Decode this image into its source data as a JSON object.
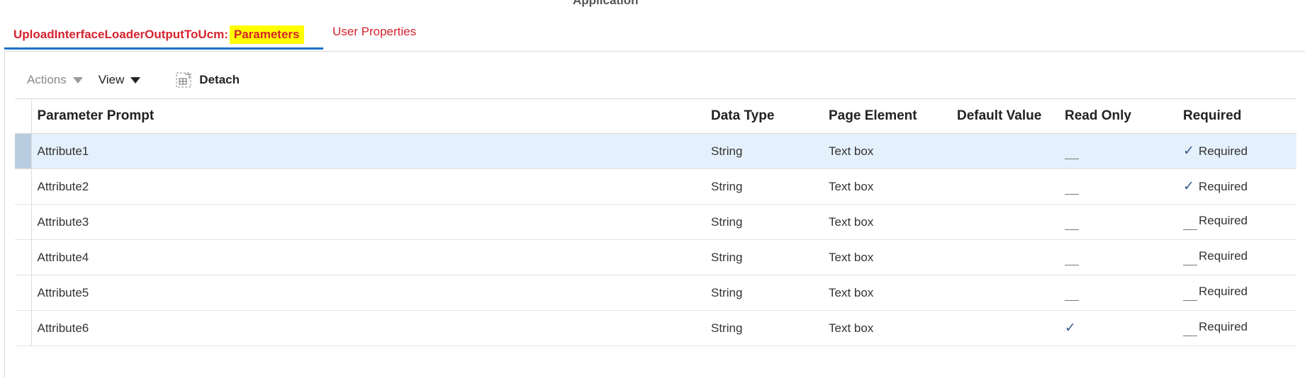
{
  "header": {
    "cut_title": "Application"
  },
  "tabs": {
    "active_prefix": "UploadInterfaceLoaderOutputToUcm:",
    "active_highlight": "Parameters",
    "user_properties": "User Properties"
  },
  "toolbar": {
    "actions_label": "Actions",
    "view_label": "View",
    "detach_label": "Detach"
  },
  "table": {
    "columns": [
      "Parameter Prompt",
      "Data Type",
      "Page Element",
      "Default Value",
      "Read Only",
      "Required"
    ],
    "rows": [
      {
        "prompt": "Attribute1",
        "type": "String",
        "element": "Text box",
        "default": "",
        "read_only": false,
        "required": true,
        "required_label": "Required",
        "selected": true
      },
      {
        "prompt": "Attribute2",
        "type": "String",
        "element": "Text box",
        "default": "",
        "read_only": false,
        "required": true,
        "required_label": "Required",
        "selected": false
      },
      {
        "prompt": "Attribute3",
        "type": "String",
        "element": "Text box",
        "default": "",
        "read_only": false,
        "required": false,
        "required_label": "Required",
        "selected": false
      },
      {
        "prompt": "Attribute4",
        "type": "String",
        "element": "Text box",
        "default": "",
        "read_only": false,
        "required": false,
        "required_label": "Required",
        "selected": false
      },
      {
        "prompt": "Attribute5",
        "type": "String",
        "element": "Text box",
        "default": "",
        "read_only": false,
        "required": false,
        "required_label": "Required",
        "selected": false
      },
      {
        "prompt": "Attribute6",
        "type": "String",
        "element": "Text box",
        "default": "",
        "read_only": true,
        "required": false,
        "required_label": "Required",
        "selected": false
      }
    ]
  },
  "colors": {
    "tab_red": "#d5232e",
    "tab_underline": "#1b72c9",
    "highlight_yellow": "#ffff00",
    "selected_row": "#e4f0fb",
    "check_blue": "#3a5a8c"
  }
}
